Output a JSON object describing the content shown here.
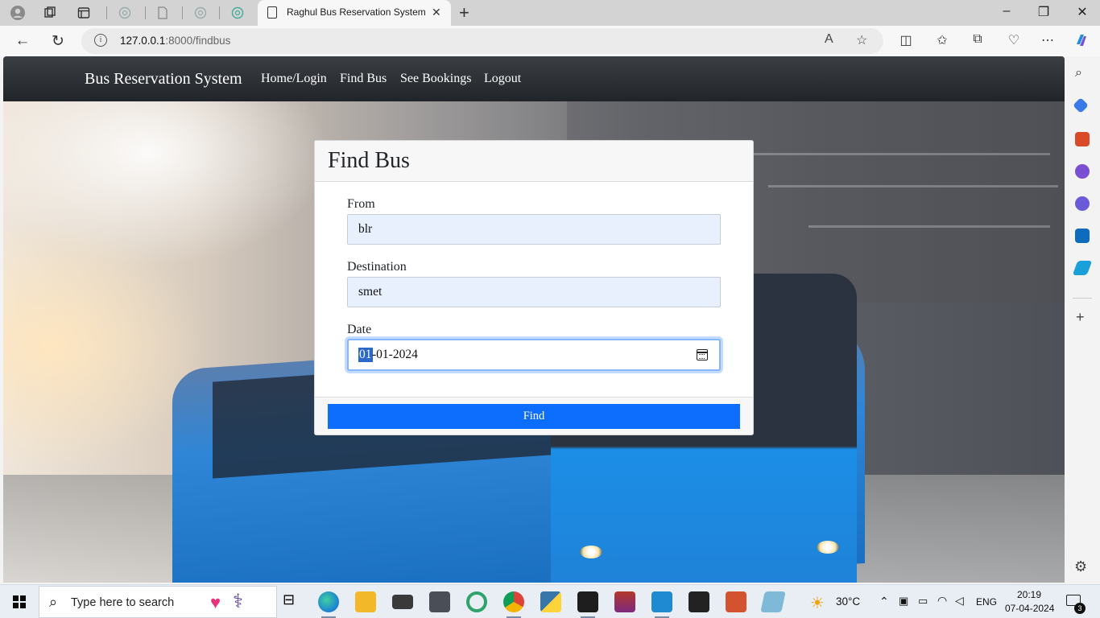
{
  "browser": {
    "active_tab_title": "Raghul Bus Reservation System",
    "url_host": "127.0.0.1",
    "url_rest": ":8000/findbus"
  },
  "nav": {
    "brand": "Bus Reservation System",
    "links": [
      "Home/Login",
      "Find Bus",
      "See Bookings",
      "Logout"
    ]
  },
  "form": {
    "title": "Find Bus",
    "from_label": "From",
    "from_value": "blr",
    "destination_label": "Destination",
    "destination_value": "smet",
    "date_label": "Date",
    "date_day": "01",
    "date_rest": "-01-2024",
    "submit_label": "Find"
  },
  "taskbar": {
    "search_placeholder": "Type here to search",
    "weather": "30°C",
    "language": "ENG",
    "time": "20:19",
    "date": "07-04-2024",
    "notifications": "3"
  },
  "colors": {
    "navbar": "#212529",
    "primary_button": "#0d6efd",
    "autofill_field": "#e8f0fe",
    "focus_ring": "#86b7fe"
  }
}
